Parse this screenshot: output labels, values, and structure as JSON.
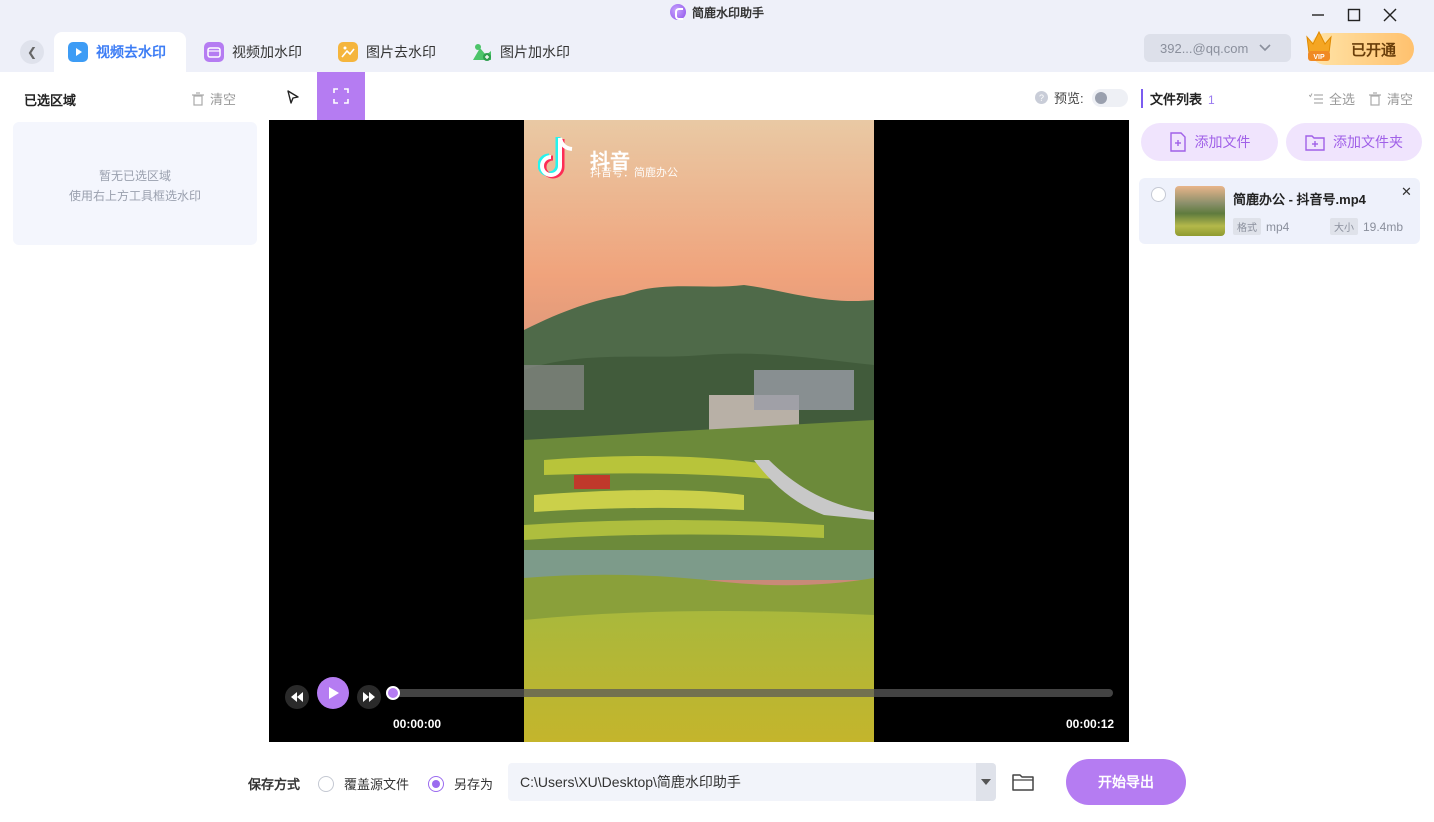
{
  "app": {
    "title": "简鹿水印助手"
  },
  "tabs": [
    {
      "label": "视频去水印",
      "active": true,
      "icon": "video-remove-icon",
      "color": "#3d7df5"
    },
    {
      "label": "视频加水印",
      "active": false,
      "icon": "video-add-icon",
      "color": "#b57cf2"
    },
    {
      "label": "图片去水印",
      "active": false,
      "icon": "image-remove-icon",
      "color": "#f5a623"
    },
    {
      "label": "图片加水印",
      "active": false,
      "icon": "image-add-icon",
      "color": "#4cc46a"
    }
  ],
  "account": {
    "email": "392...@qq.com",
    "vip_label": "已开通",
    "vip_badge": "VIP"
  },
  "left_panel": {
    "title": "已选区域",
    "clear_label": "清空",
    "empty_line1": "暂无已选区域",
    "empty_line2": "使用右上方工具框选水印"
  },
  "toolbar": {
    "select_tool": "pointer-icon",
    "rect_tool": "rect-select-icon",
    "rect_active": true
  },
  "preview": {
    "label": "预览:",
    "enabled": false
  },
  "files": {
    "title": "文件列表",
    "count": "1",
    "select_all": "全选",
    "clear": "清空",
    "add_file": "添加文件",
    "add_folder": "添加文件夹",
    "items": [
      {
        "name": "简鹿办公 - 抖音号.mp4",
        "format_tag": "格式",
        "format": "mp4",
        "size_tag": "大小",
        "size": "19.4mb"
      }
    ]
  },
  "video": {
    "watermark_brand": "抖音",
    "watermark_account": "抖音号：简鹿办公",
    "current_time": "00:00:00",
    "total_time": "00:00:12",
    "progress": 0.0
  },
  "bottom": {
    "save_label": "保存方式",
    "option_overwrite": "覆盖源文件",
    "option_saveas": "另存为",
    "selected": "saveas",
    "path": "C:\\Users\\XU\\Desktop\\简鹿水印助手",
    "export_label": "开始导出"
  },
  "colors": {
    "accent": "#b57cf2",
    "tab_active": "#3d7df5"
  }
}
